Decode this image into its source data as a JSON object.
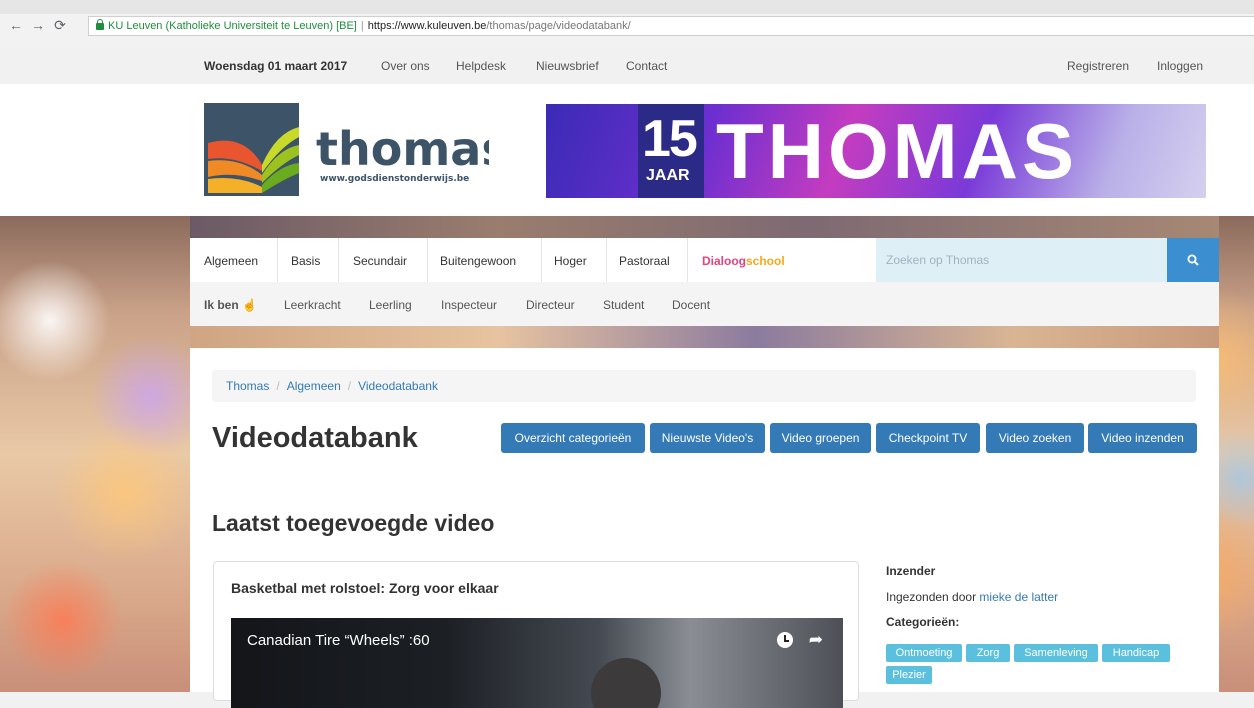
{
  "browser": {
    "site_identity": "KU Leuven (Katholieke Universiteit te Leuven) [BE]",
    "url_host": "https://www.kuleuven.be",
    "url_path": "/thomas/page/videodatabank/"
  },
  "topbar": {
    "date": "Woensdag 01 maart 2017",
    "links": [
      "Over ons",
      "Helpdesk",
      "Nieuwsbrief",
      "Contact"
    ],
    "register": "Registreren",
    "login": "Inloggen"
  },
  "header": {
    "logo_text": "thomas",
    "logo_url": "www.godsdienstonderwijs.be",
    "banner_number": "15",
    "banner_jaar": "JAAR",
    "banner_title": "THOMAS"
  },
  "mainnav": {
    "items": [
      "Algemeen",
      "Basis",
      "Secundair",
      "Buitengewoon",
      "Hoger",
      "Pastoraal"
    ],
    "dialoog_a": "Dialoog",
    "dialoog_b": "school",
    "search_placeholder": "Zoeken op Thomas"
  },
  "subnav": {
    "ikben": "Ik ben ☝",
    "items": [
      "Leerkracht",
      "Leerling",
      "Inspecteur",
      "Directeur",
      "Student",
      "Docent"
    ]
  },
  "breadcrumb": [
    "Thomas",
    "Algemeen",
    "Videodatabank"
  ],
  "page": {
    "title": "Videodatabank",
    "buttons": [
      "Overzicht categorieën",
      "Nieuwste Video's",
      "Video groepen",
      "Checkpoint TV",
      "Video zoeken",
      "Video inzenden"
    ],
    "section_title": "Laatst toegevoegde video"
  },
  "video": {
    "title": "Basketbal met rolstoel: Zorg voor elkaar",
    "caption": "Canadian Tire “Wheels” :60"
  },
  "sidebar": {
    "inzender_label": "Inzender",
    "ingezonden_prefix": "Ingezonden door",
    "author": "mieke de latter",
    "categories_label": "Categorieën:",
    "tags": [
      "Ontmoeting",
      "Zorg",
      "Samenleving",
      "Handicap",
      "Plezier"
    ]
  },
  "colors": {
    "accent": "#337ab7",
    "tag": "#5bc0de",
    "search_button": "#3b8fd1",
    "ikben": "#e08019"
  }
}
